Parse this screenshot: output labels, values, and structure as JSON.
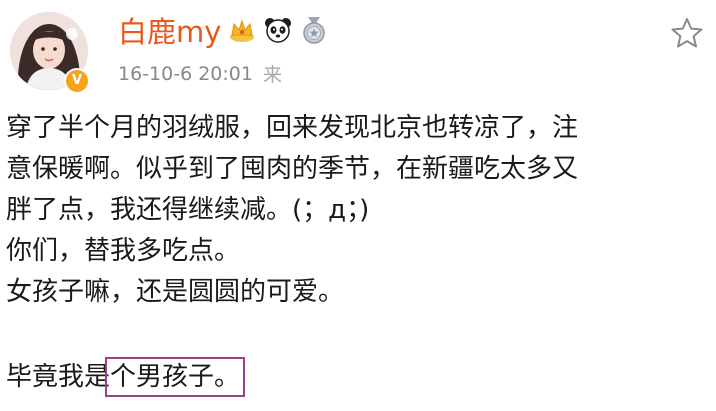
{
  "header": {
    "username": "白鹿my",
    "badges": [
      "crown-badge",
      "panda-badge",
      "medal-badge"
    ],
    "timestamp": "16-10-6 20:01",
    "source": "来",
    "verified_mark": "V"
  },
  "post": {
    "lines": [
      "穿了半个月的羽绒服，回来发现北京也转凉了，注",
      "意保暖啊。似乎到了囤肉的季节，在新疆吃太多又",
      "胖了点，我还得继续减。(；д；)",
      "你们，替我多吃点。",
      "女孩子嘛，还是圆圆的可爱。"
    ],
    "final_line_prefix": "毕竟我是",
    "final_line_highlight": "个男孩子。"
  },
  "colors": {
    "username": "#e8581c",
    "meta": "#888888",
    "highlight_box": "#9b3f8f",
    "verified": "#f7a21b"
  }
}
